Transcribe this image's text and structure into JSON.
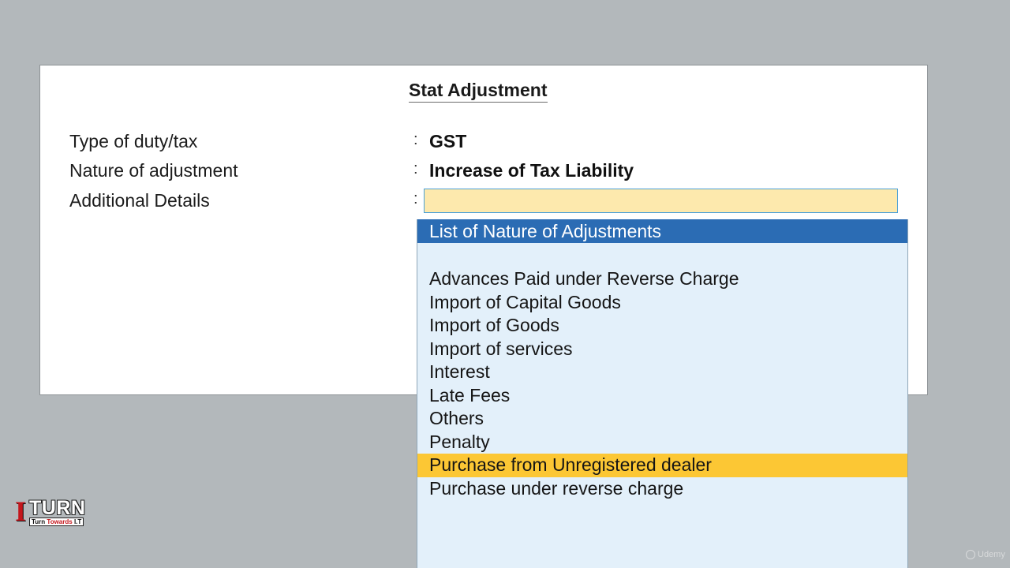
{
  "panel": {
    "title": "Stat Adjustment",
    "fields": [
      {
        "label": "Type of duty/tax",
        "colon": ":",
        "value": "GST"
      },
      {
        "label": "Nature of adjustment",
        "colon": ":",
        "value": "Increase of Tax Liability"
      },
      {
        "label": "Additional Details",
        "colon": ":",
        "value": ""
      }
    ]
  },
  "list": {
    "title": "List of Nature of Adjustments",
    "items": [
      "Advances Paid under Reverse Charge",
      "Import of Capital Goods",
      "Import of Goods",
      "Import of services",
      "Interest",
      "Late Fees",
      "Others",
      "Penalty",
      "Purchase from Unregistered dealer",
      "Purchase under reverse charge"
    ],
    "selected_index": 8
  },
  "logo": {
    "letter": "I",
    "word": "TURN",
    "tagline_prefix": "Turn ",
    "tagline_highlight": "Towards",
    "tagline_suffix": " I.T"
  },
  "watermark": {
    "text": "Udemy"
  },
  "colors": {
    "background": "#b3b8bb",
    "list_header": "#2b6cb4",
    "list_background": "#e3f0fa",
    "selected_item": "#fcc734",
    "input_fill": "#fde9ad",
    "logo_red": "#c4161c"
  }
}
